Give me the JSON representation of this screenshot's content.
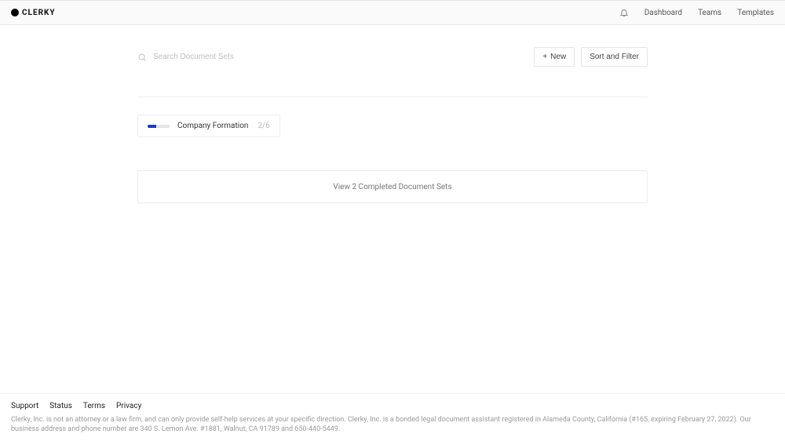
{
  "header": {
    "brand": "CLERKY",
    "nav": {
      "dashboard": "Dashboard",
      "teams": "Teams",
      "templates": "Templates"
    }
  },
  "search": {
    "placeholder": "Search Document Sets"
  },
  "actions": {
    "new_label": "New",
    "sort_filter_label": "Sort and Filter"
  },
  "docset": {
    "title": "Company Formation",
    "progress_label": "2/6"
  },
  "completed": {
    "label": "View 2 Completed Document Sets"
  },
  "footer": {
    "links": {
      "support": "Support",
      "status": "Status",
      "terms": "Terms",
      "privacy": "Privacy"
    },
    "disclaimer": "Clerky, Inc. is not an attorney or a law firm, and can only provide self-help services at your specific direction. Clerky, Inc. is a bonded legal document assistant registered in Alameda County, California (#165, expiring February 27, 2022). Our business address and phone number are 340 S. Lemon Ave. #1881, Walnut, CA 91789 and 650-440-5449."
  }
}
